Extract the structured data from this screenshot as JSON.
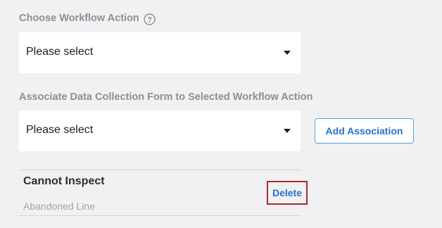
{
  "workflow_action": {
    "label": "Choose Workflow Action",
    "help_icon": "question-circle-icon",
    "select_value": "Please select"
  },
  "data_collection": {
    "label": "Associate Data Collection Form to Selected Workflow Action",
    "select_value": "Please select",
    "add_button_label": "Add Association"
  },
  "associations": [
    {
      "title": "Cannot Inspect",
      "subtitle": "Abandoned Line",
      "delete_label": "Delete"
    }
  ],
  "colors": {
    "accent": "#2a6fd1",
    "highlight_border": "#b3262b",
    "background": "#f1f1f3"
  }
}
